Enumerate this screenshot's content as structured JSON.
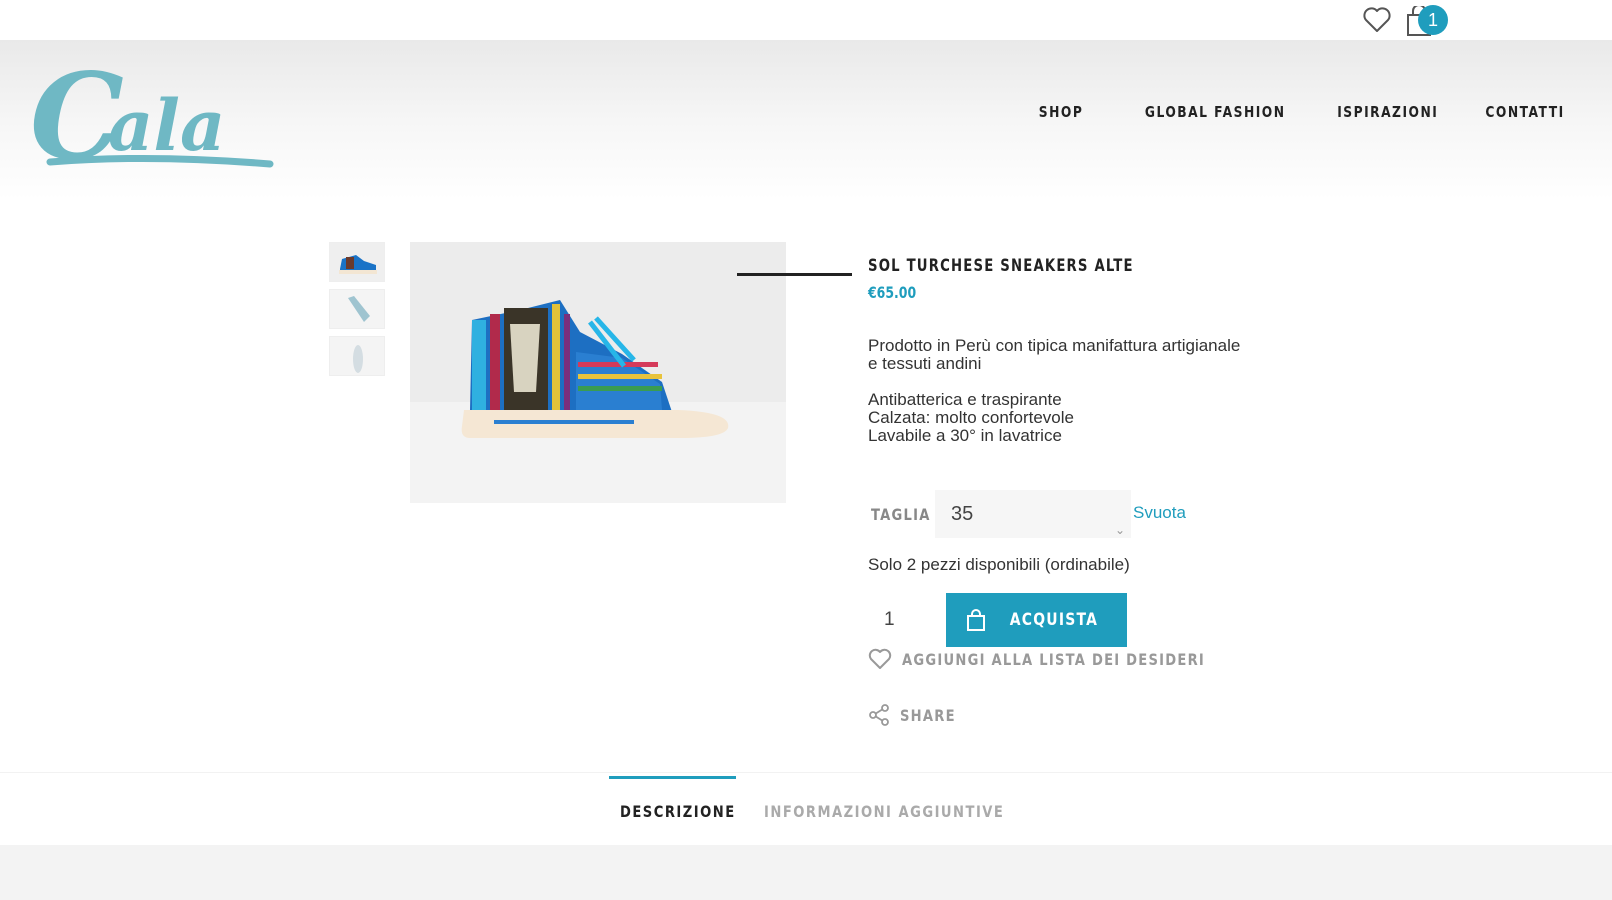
{
  "topbar": {
    "wishlist_icon": "heart-icon",
    "cart_icon": "shopping-bag-icon",
    "cart_count": "1"
  },
  "brand": {
    "logo_text": "Cala",
    "logo_color": "#6fb8c4"
  },
  "nav": {
    "items": [
      {
        "label": "SHOP"
      },
      {
        "label": "GLOBAL FASHION"
      },
      {
        "label": "ISPIRAZIONI"
      },
      {
        "label": "CONTATTI"
      }
    ]
  },
  "product": {
    "title": "SOL TURCHESE SNEAKERS ALTE",
    "price": "€65.00",
    "description": {
      "line1": "Prodotto in Perù con tipica manifattura artigianale",
      "line2": "e tessuti andini",
      "line3": "Antibatterica e traspirante",
      "line4": "Calzata: molto confortevole",
      "line5": "Lavabile a 30° in lavatrice"
    },
    "size_label": "TAGLIA",
    "size_value": "35",
    "clear_label": "Svuota",
    "stock_text": "Solo 2 pezzi disponibili (ordinabile)",
    "quantity": "1",
    "buy_label": "ACQUISTA",
    "wishlist_label": "AGGIUNGI ALLA LISTA DEI DESIDERI",
    "share_label": "SHARE"
  },
  "tabs": [
    {
      "label": "DESCRIZIONE",
      "active": true
    },
    {
      "label": "INFORMAZIONI AGGIUNTIVE",
      "active": false
    }
  ],
  "colors": {
    "accent": "#1f9dbd",
    "text": "#222222",
    "muted": "#999999"
  }
}
